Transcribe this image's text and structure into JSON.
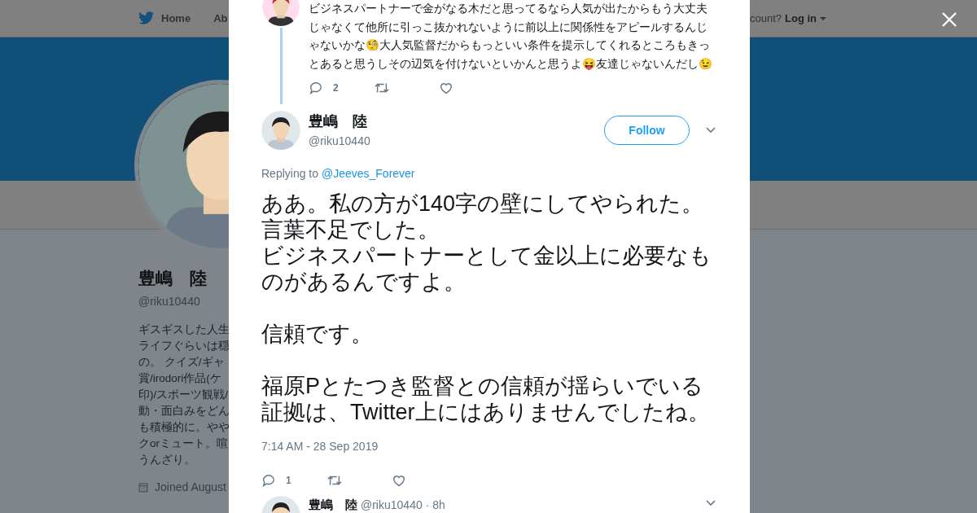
{
  "nav": {
    "items": [
      {
        "label": "Home",
        "selected": false
      },
      {
        "label": "Ab",
        "selected": false
      }
    ],
    "account_prompt": "count?",
    "login": "Log in"
  },
  "profile": {
    "name": "豊嶋　陸",
    "handle": "@riku10440",
    "bio_lines": [
      "ギスギスした人生",
      "ライフぐらいは穏",
      "の。 クイズ/ギャ",
      "賞/irodori作品(ケ",
      "印)/スポーツ観戦/",
      "動・面白みをどん",
      "も積極的に。やや",
      "クorミュート。喧",
      "うんざり。"
    ],
    "joined": "Joined August"
  },
  "parent_tweet": {
    "text": "ビジネスパートナーで金がなる木だと思ってるなら人気が出たからもう大丈夫じゃなくて他所に引っこ抜かれないように前以上に関係性をアピールするんじゃないかな🧐大人気監督だからもっといい条件を提示してくれるところもきっとあると思うしその辺気を付けないといかんと思うよ😝友達じゃないんだし😉",
    "replies": "2",
    "liked": false
  },
  "tweet": {
    "name": "豊嶋　陸",
    "handle": "@riku10440",
    "follow": "Follow",
    "replying_to": "Replying to",
    "reply_handle": "@Jeeves_Forever",
    "paragraphs": [
      [
        "ああ。私の方が140字の壁にしてやられた。",
        "言葉不足でした。",
        "ビジネスパートナーとして金以上に必要なものがあるんですよ。"
      ],
      [
        "信頼です。"
      ],
      [
        "福原Pとたつき監督との信頼が揺らいでいる",
        "証拠は、Twitter上にはありませんでしたね。"
      ]
    ],
    "timestamp": "7:14 AM - 28 Sep 2019",
    "replies": "1",
    "liked": false
  },
  "next_tweet": {
    "name": "豊嶋　陸",
    "meta": "@riku10440 · 8h"
  }
}
